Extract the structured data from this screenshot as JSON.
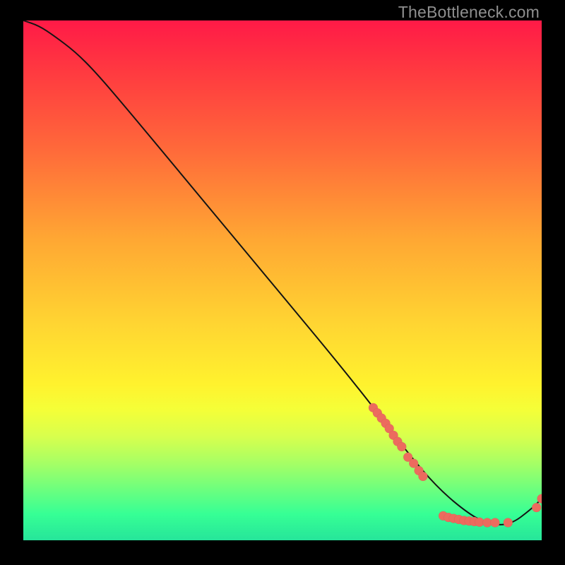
{
  "watermark": "TheBottleneck.com",
  "colors": {
    "dot": "#ec6b5e",
    "curve": "#141414",
    "background": "#000000"
  },
  "chart_data": {
    "type": "line",
    "title": "",
    "xlabel": "",
    "ylabel": "",
    "legend": false,
    "grid": false,
    "xlim": [
      0,
      100
    ],
    "ylim": [
      0,
      100
    ],
    "curve": {
      "name": "bottleneck-curve",
      "x": [
        0,
        3,
        6,
        10,
        14,
        20,
        30,
        40,
        50,
        60,
        68,
        74,
        80,
        86,
        90,
        94,
        98,
        100
      ],
      "y": [
        100,
        99,
        97,
        94,
        90,
        83,
        71,
        59,
        47,
        35,
        25,
        17,
        10,
        5,
        3,
        3,
        6,
        8
      ]
    },
    "series": [
      {
        "name": "cluster-upper",
        "type": "scatter",
        "x": [
          67.5,
          68.3,
          69.1,
          69.9,
          70.6,
          71.4,
          72.2,
          73.0,
          74.2,
          75.3,
          76.3,
          77.1
        ],
        "y": [
          25.5,
          24.5,
          23.5,
          22.5,
          21.5,
          20.2,
          19.0,
          18.0,
          16.0,
          14.8,
          13.4,
          12.3
        ]
      },
      {
        "name": "cluster-lower",
        "type": "scatter",
        "x": [
          81.0,
          82.0,
          83.0,
          84.0,
          85.0,
          86.0,
          87.0,
          88.0,
          89.5,
          91.0,
          93.5
        ],
        "y": [
          4.7,
          4.4,
          4.2,
          4.0,
          3.8,
          3.7,
          3.6,
          3.5,
          3.4,
          3.4,
          3.4
        ]
      },
      {
        "name": "end-points",
        "type": "scatter",
        "x": [
          99.0,
          100.0
        ],
        "y": [
          6.3,
          8.0
        ]
      }
    ]
  }
}
